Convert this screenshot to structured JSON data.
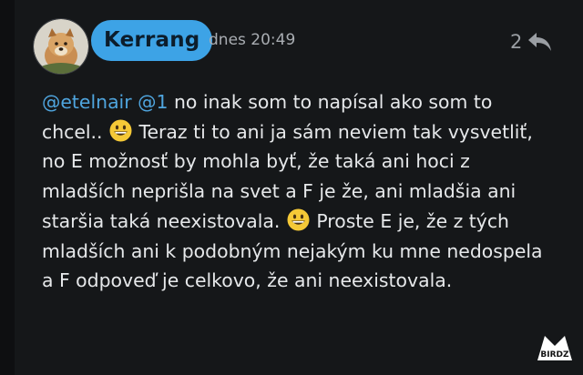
{
  "post": {
    "author": "Kerrang",
    "timestamp": "dnes 20:49",
    "reply_count": "2",
    "avatar_icon": "dog-avatar",
    "reply_icon": "reply-arrow-icon",
    "accent_color": "#3da3e6",
    "mention_color": "#4fa5de"
  },
  "message": {
    "mention_user": "@etelnair",
    "mention_ref": "@1",
    "seg1": " no inak som to napísal ako som to chcel.. ",
    "emoji1": "grinning-face-emoji",
    "seg2": " Teraz ti to ani ja sám neviem tak vysvetliť, no E možnosť by mohla byť, že taká ani hoci z mladších neprišla na svet a F je že, ani mladšia ani staršia taká neexistovala. ",
    "emoji2": "grinning-face-emoji",
    "seg3": " Proste E je, že z tých mladších ani k podobným nejakým ku mne nedospela a F odpoveď je celkovo, že ani neexistovala."
  },
  "watermark": {
    "text": "BIRDZ"
  }
}
